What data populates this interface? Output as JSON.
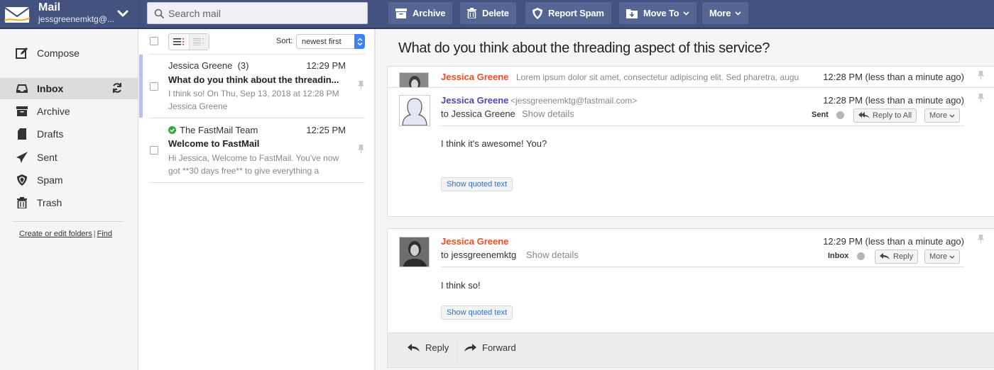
{
  "topbar": {
    "app_title": "Mail",
    "account": "jessgreenemktg@...",
    "search_placeholder": "Search mail",
    "actions": [
      {
        "label": "Archive",
        "icon": "archive-icon"
      },
      {
        "label": "Delete",
        "icon": "trash-icon"
      },
      {
        "label": "Report Spam",
        "icon": "shield-icon"
      },
      {
        "label": "Move To",
        "icon": "move-folder-icon",
        "dropdown": true
      },
      {
        "label": "More",
        "dropdown": true
      }
    ]
  },
  "sidebar": {
    "compose_label": "Compose",
    "items": [
      {
        "label": "Inbox",
        "icon": "inbox-icon",
        "active": true
      },
      {
        "label": "Archive",
        "icon": "archive-icon"
      },
      {
        "label": "Drafts",
        "icon": "drafts-icon"
      },
      {
        "label": "Sent",
        "icon": "sent-icon"
      },
      {
        "label": "Spam",
        "icon": "spam-icon"
      },
      {
        "label": "Trash",
        "icon": "trash-icon"
      }
    ],
    "links": {
      "edit_folders": "Create or edit folders",
      "separator": "|",
      "find": "Find"
    }
  },
  "message_list": {
    "sort_label": "Sort:",
    "sort_value": "newest first",
    "messages": [
      {
        "from": "Jessica Greene",
        "count": "(3)",
        "time": "12:29 PM",
        "subject": "What do you think about the threadin...",
        "preview": "I think so! On Thu, Sep 13, 2018 at 12:28 PM Jessica Greene",
        "selected": true
      },
      {
        "from": "The FastMail Team",
        "verified": true,
        "time": "12:25 PM",
        "subject": "Welcome to FastMail",
        "preview": "Hi Jessica, Welcome to FastMail. You've now got **30 days free** to give everything a",
        "selected": false
      }
    ]
  },
  "thread": {
    "title": "What do you think about the threading aspect of this service?",
    "collapsed": {
      "sender": "Jessica Greene",
      "snippet": "Lorem ipsum dolor sit amet, consectetur adipiscing elit. Sed pharetra, augu",
      "time": "12:28 PM (less than a minute ago)"
    },
    "messages": [
      {
        "sender": "Jessica Greene",
        "email": "<jessgreenemktg@fastmail.com>",
        "to": "to Jessica Greene",
        "show_details": "Show details",
        "time": "12:28 PM (less than a minute ago)",
        "folder": "Sent",
        "reply_label": "Reply to All",
        "more_label": "More",
        "body": "I think it's awesome! You?",
        "quoted_label": "Show quoted text"
      },
      {
        "sender": "Jessica Greene",
        "to": "to jessgreenemktg",
        "show_details": "Show details",
        "time": "12:29 PM (less than a minute ago)",
        "folder": "Inbox",
        "reply_label": "Reply",
        "more_label": "More",
        "body": "I think so!",
        "quoted_label": "Show quoted text"
      }
    ],
    "footer": {
      "reply_label": "Reply",
      "forward_label": "Forward"
    }
  },
  "colors": {
    "topbar": "#43527f",
    "topbar_button": "#566694",
    "sender_red": "#ff4a1c",
    "sender_blue": "#5145b5",
    "link_blue": "#2a6fd6",
    "verified_green": "#2eaa3c",
    "selection_bar": "#b7c1ec"
  }
}
